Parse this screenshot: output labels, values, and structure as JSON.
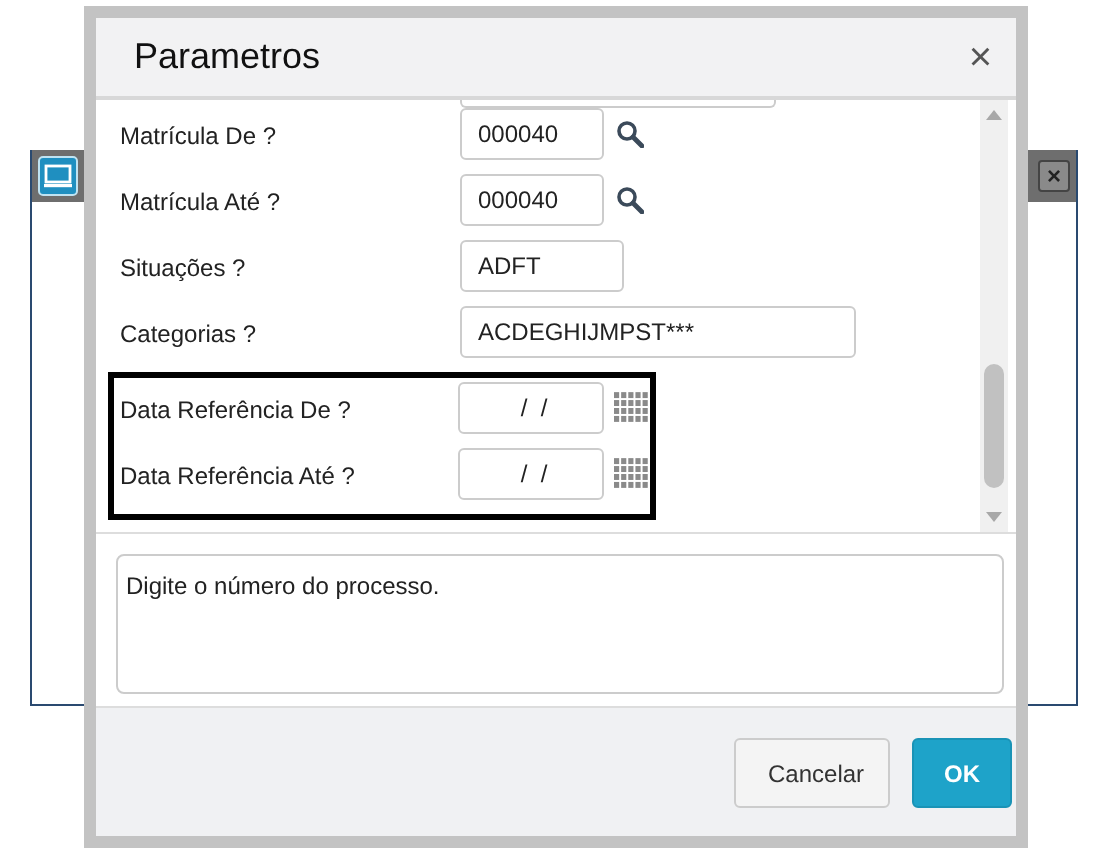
{
  "background_window": {
    "close": "×"
  },
  "dialog": {
    "title": "Parametros",
    "close": "×"
  },
  "rows": [
    {
      "kind": "partial"
    },
    {
      "kind": "lookup",
      "label": "Matrícula De ?",
      "value": "000040",
      "highlighted": false
    },
    {
      "kind": "lookup",
      "label": "Matrícula Até ?",
      "value": "000040",
      "highlighted": false
    },
    {
      "kind": "short",
      "label": "Situações ?",
      "value": "ADFT",
      "highlighted": false
    },
    {
      "kind": "long",
      "label": "Categorias ?",
      "value": "ACDEGHIJMPST***",
      "highlighted": false
    },
    {
      "kind": "date",
      "label": "Data Referência De ?",
      "value": " /  /",
      "highlighted": true
    },
    {
      "kind": "date",
      "label": "Data Referência Até ?",
      "value": " /  /",
      "highlighted": true
    }
  ],
  "help": "Digite o número do processo.",
  "buttons": [
    {
      "label": "Cancelar",
      "kind": "secondary"
    },
    {
      "label": "OK",
      "kind": "primary"
    }
  ]
}
